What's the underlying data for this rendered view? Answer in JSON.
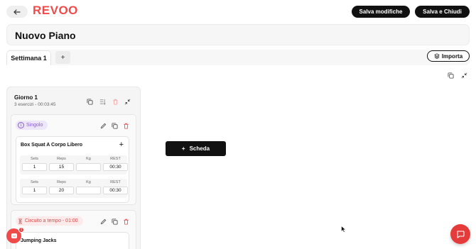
{
  "header": {
    "brand": "REVOO",
    "save_changes_label": "Salva modifiche",
    "save_close_label": "Salva e Chiudi"
  },
  "plan": {
    "title": "Nuovo Piano"
  },
  "tabs": {
    "week_label": "Settimana 1",
    "add_label": "+",
    "import_label": "Importa"
  },
  "day": {
    "title": "Giorno 1",
    "subtitle": "3 esercizi - 00:03:45",
    "blocks": [
      {
        "type_label": "Singolo",
        "number": "1",
        "exercise": {
          "name": "Box Squat A Corpo Libero",
          "add_label": "+",
          "columns": [
            "Sets",
            "Reps",
            "Kg",
            "REST"
          ],
          "rows": [
            {
              "sets": "1",
              "reps": "15",
              "kg": "",
              "rest": "00:30"
            },
            {
              "sets": "1",
              "reps": "20",
              "kg": "",
              "rest": "00:30"
            }
          ]
        }
      },
      {
        "type_label": "Circuito a tempo - 01:00",
        "exercise": {
          "name": "Jumping Jacks"
        }
      }
    ]
  },
  "scheda": {
    "label": "Scheda",
    "plus": "+"
  },
  "messenger": {
    "badge": "1"
  },
  "colors": {
    "brand": "#ef4b4b",
    "single": "#8a5cd0",
    "circuit": "#d94b4b"
  }
}
